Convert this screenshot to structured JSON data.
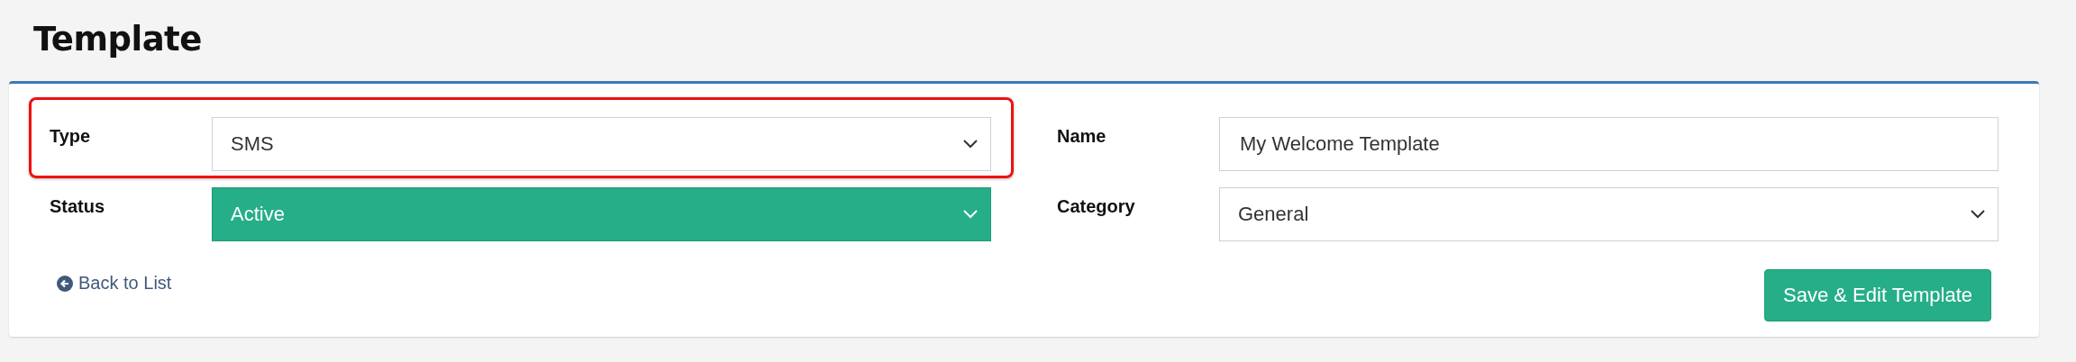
{
  "page": {
    "title": "Template"
  },
  "left_fields": [
    {
      "label": "Type",
      "kind": "select",
      "value": "SMS",
      "status_color": false,
      "highlighted": true
    },
    {
      "label": "Status",
      "kind": "select",
      "value": "Active",
      "status_color": true,
      "highlighted": false
    }
  ],
  "right_fields": [
    {
      "label": "Name",
      "kind": "text",
      "value": "My Welcome Template"
    },
    {
      "label": "Category",
      "kind": "select",
      "value": "General"
    }
  ],
  "back_link": "Back to List",
  "save_button": "Save & Edit Template"
}
